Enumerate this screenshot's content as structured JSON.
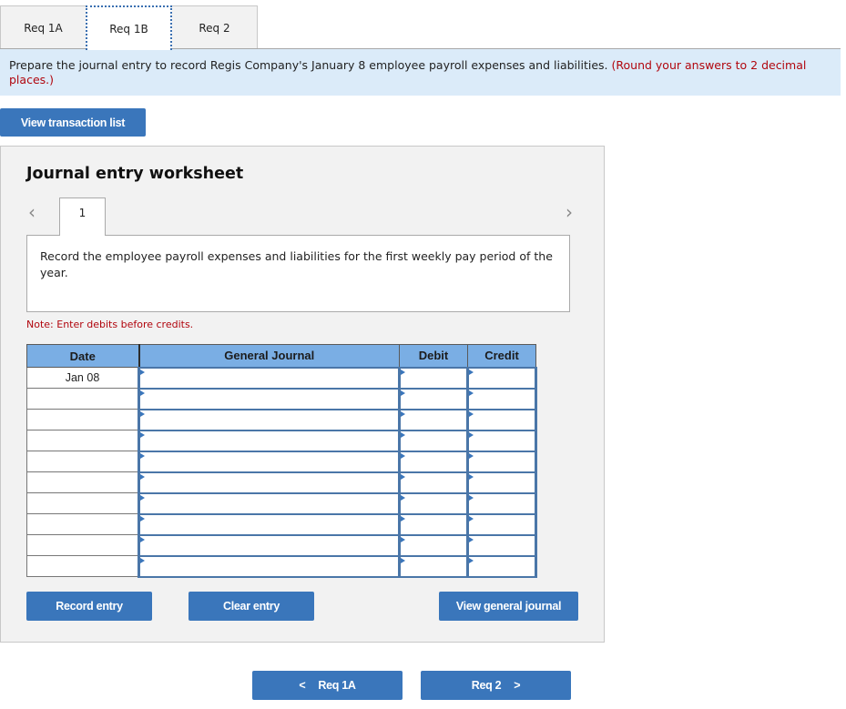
{
  "tabs": [
    {
      "label": "Req 1A",
      "active": false
    },
    {
      "label": "Req 1B",
      "active": true
    },
    {
      "label": "Req 2",
      "active": false
    }
  ],
  "instructions": {
    "text": "Prepare the journal entry to record Regis Company's January 8 employee payroll expenses and liabilities.",
    "note": "(Round your answers to 2 decimal places.)"
  },
  "view_transaction_list_label": "View transaction list",
  "worksheet": {
    "title": "Journal entry worksheet",
    "prev_icon": "chevron-left-icon",
    "next_icon": "chevron-right-icon",
    "entry_tab": "1",
    "description": "Record the employee payroll expenses and liabilities for the first weekly pay period of the year.",
    "note": "Note: Enter debits before credits.",
    "table": {
      "headers": [
        "Date",
        "General Journal",
        "Debit",
        "Credit"
      ],
      "rows": [
        {
          "date": "Jan 08",
          "account": "",
          "debit": "",
          "credit": ""
        },
        {
          "date": "",
          "account": "",
          "debit": "",
          "credit": ""
        },
        {
          "date": "",
          "account": "",
          "debit": "",
          "credit": ""
        },
        {
          "date": "",
          "account": "",
          "debit": "",
          "credit": ""
        },
        {
          "date": "",
          "account": "",
          "debit": "",
          "credit": ""
        },
        {
          "date": "",
          "account": "",
          "debit": "",
          "credit": ""
        },
        {
          "date": "",
          "account": "",
          "debit": "",
          "credit": ""
        },
        {
          "date": "",
          "account": "",
          "debit": "",
          "credit": ""
        },
        {
          "date": "",
          "account": "",
          "debit": "",
          "credit": ""
        },
        {
          "date": "",
          "account": "",
          "debit": "",
          "credit": ""
        }
      ]
    },
    "record_entry_label": "Record entry",
    "clear_entry_label": "Clear entry",
    "view_general_journal_label": "View general journal"
  },
  "nav": {
    "prev_label": "Req 1A",
    "next_label": "Req 2",
    "prev_icon": "chevron-left-icon",
    "next_icon": "chevron-right-icon"
  },
  "colors": {
    "accent": "#3a76bb",
    "instruction_bg": "#dbebf9",
    "warning_red": "#b1060e",
    "table_header": "#7aaee4"
  }
}
